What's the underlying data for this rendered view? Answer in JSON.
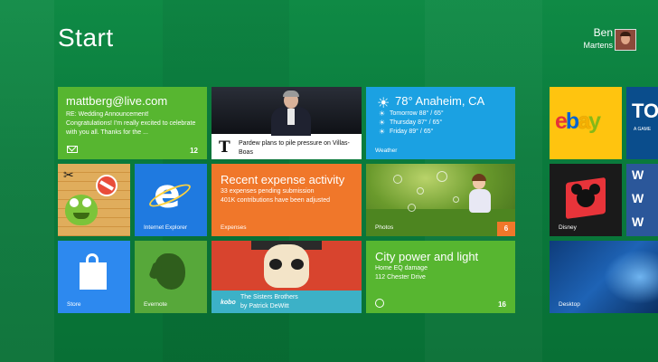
{
  "screen": {
    "title": "Start"
  },
  "user": {
    "first_name": "Ben",
    "last_name": "Martens"
  },
  "tiles": {
    "mail": {
      "account": "mattberg@live.com",
      "subject": "RE: Wedding Announcement!",
      "preview": "Congratulations! I'm really excited to celebrate with you all. Thanks for the ...",
      "count": "12",
      "icon": "envelope-icon"
    },
    "news": {
      "source_logo": "T",
      "headline": "Pardew plans to pile pressure on Villas-Boas"
    },
    "weather": {
      "current": "78° Anaheim, CA",
      "forecast": [
        "Tomorrow 88° / 65°",
        "Thursday 87° / 65°",
        "Friday 89° / 65°"
      ],
      "name": "Weather"
    },
    "ebay": {
      "logo": "ebay"
    },
    "toyota": {
      "logo": "TO",
      "tagline": "A GAME"
    },
    "rope": {
      "name": "Cut the Rope"
    },
    "ie": {
      "name": "Internet Explorer"
    },
    "expenses": {
      "title": "Recent expense activity",
      "line1": "33 expenses pending submission",
      "line2": "401K contributions have been adjusted",
      "name": "Expenses"
    },
    "photos": {
      "name": "Photos",
      "count": "6"
    },
    "disney": {
      "name": "Disney"
    },
    "word": {
      "letters": [
        "W",
        "W",
        "W"
      ]
    },
    "store": {
      "name": "Store"
    },
    "evernote": {
      "name": "Evernote"
    },
    "book": {
      "brand": "kobo",
      "title": "The Sisters Brothers",
      "author": "by Patrick DeWitt"
    },
    "city": {
      "title": "City power and light",
      "line1": "Home EQ damage",
      "line2": "112 Chester Drive",
      "count": "16"
    },
    "desktop": {
      "name": "Desktop"
    }
  },
  "colors": {
    "background": "#0b7a3e",
    "green": "#57b630",
    "blue": "#1ba1e2",
    "orange": "#f0772a",
    "yellow": "#ffc40f"
  }
}
